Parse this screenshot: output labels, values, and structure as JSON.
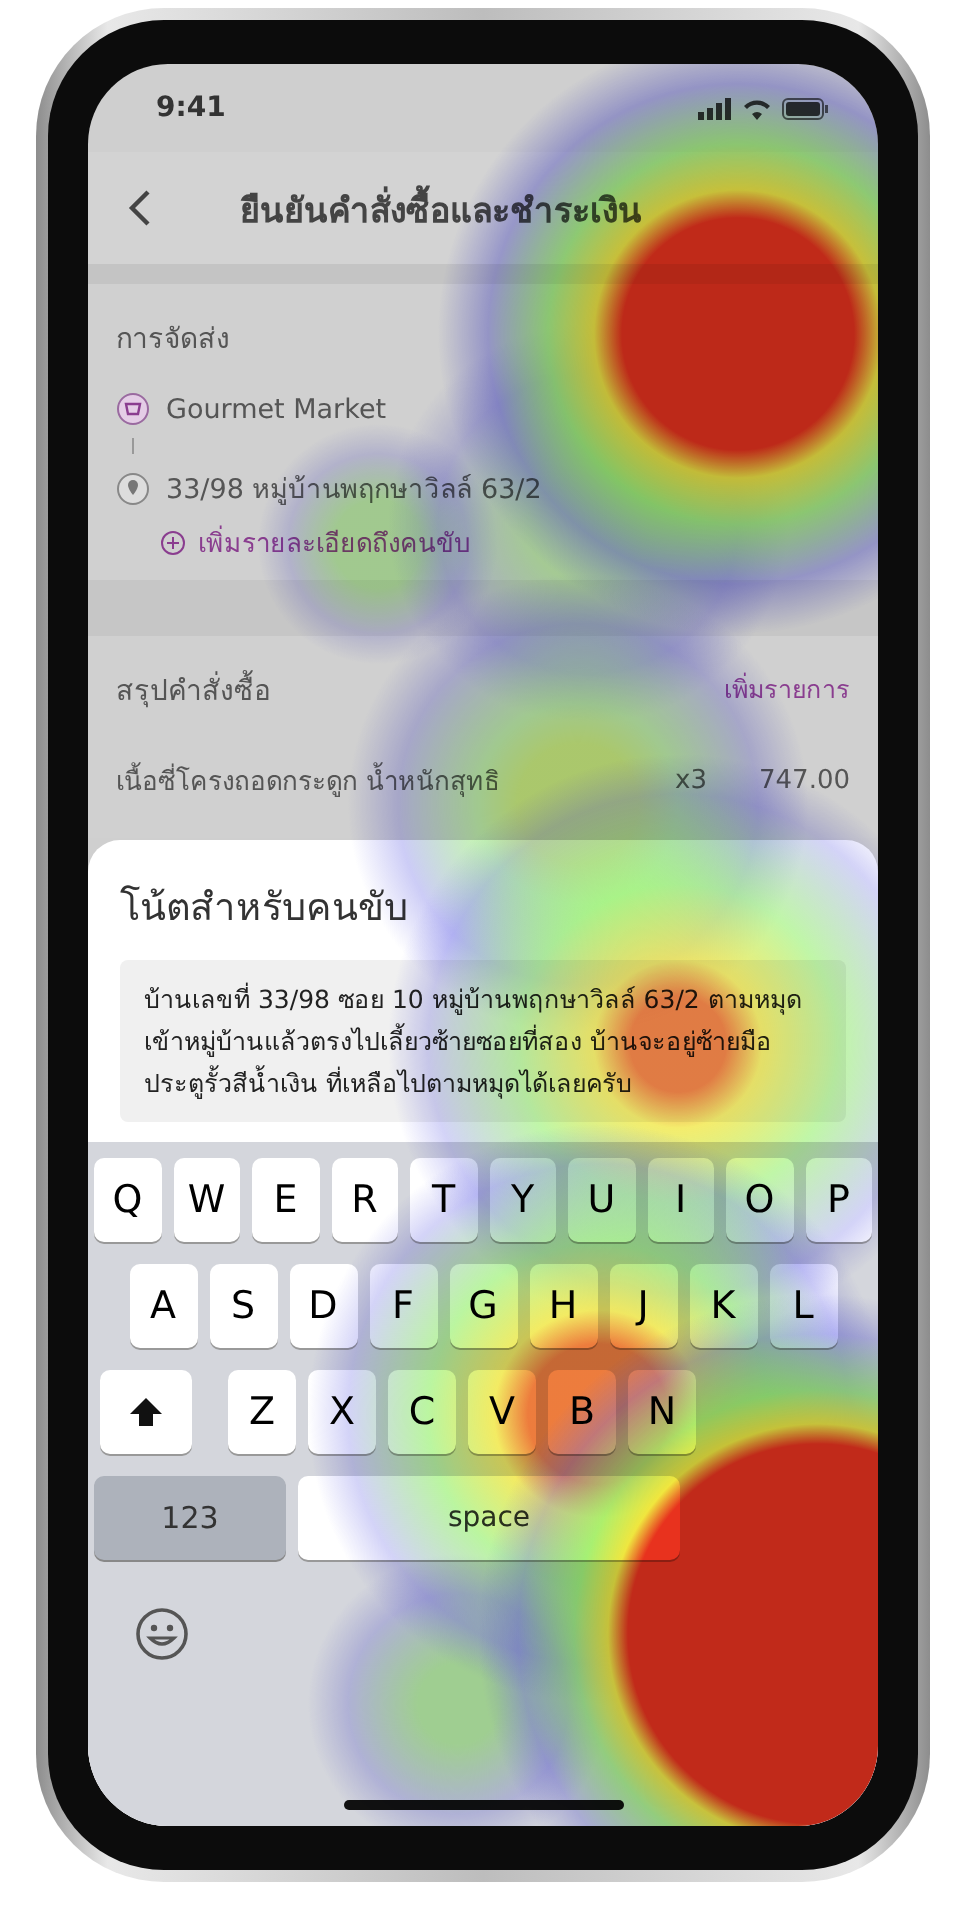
{
  "status_bar": {
    "time": "9:41"
  },
  "header": {
    "title": "ยืนยันคำสั่งซื้อและชำระเงิน"
  },
  "delivery": {
    "title": "การจัดส่ง",
    "store": "Gourmet Market",
    "address": "33/98 หมู่บ้านพฤกษาวิลล์ 63/2",
    "add_note_link": "เพิ่มรายละเอียดถึงคนขับ"
  },
  "order_summary": {
    "title": "สรุปคำสั่งซื้อ",
    "add_items_link": "เพิ่มรายการ",
    "items": [
      {
        "name": "เนื้อซี่โครงถอดกระดูก น้ำหนักสุทธิ",
        "quantity": "x3",
        "price": "747.00"
      }
    ]
  },
  "driver_note_sheet": {
    "title": "โน้ตสำหรับคนขับ",
    "note": "บ้านเลขที่ 33/98 ซอย 10 หมู่บ้านพฤกษาวิลล์ 63/2 ตามหมุด เข้าหมู่บ้านแล้วตรงไปเลี้ยวซ้ายซอยที่สอง บ้านจะอยู่ซ้ายมือ ประตูรั้วสีน้ำเงิน ที่เหลือไปตามหมุดได้เลยครับ"
  },
  "keyboard": {
    "rows": [
      [
        "Q",
        "W",
        "E",
        "R",
        "T",
        "Y",
        "U",
        "I",
        "O",
        "P"
      ],
      [
        "A",
        "S",
        "D",
        "F",
        "G",
        "H",
        "J",
        "K",
        "L"
      ],
      [
        "Z",
        "X",
        "C",
        "V",
        "B",
        "N"
      ]
    ],
    "numbers_key": "123",
    "space_key": "space"
  }
}
